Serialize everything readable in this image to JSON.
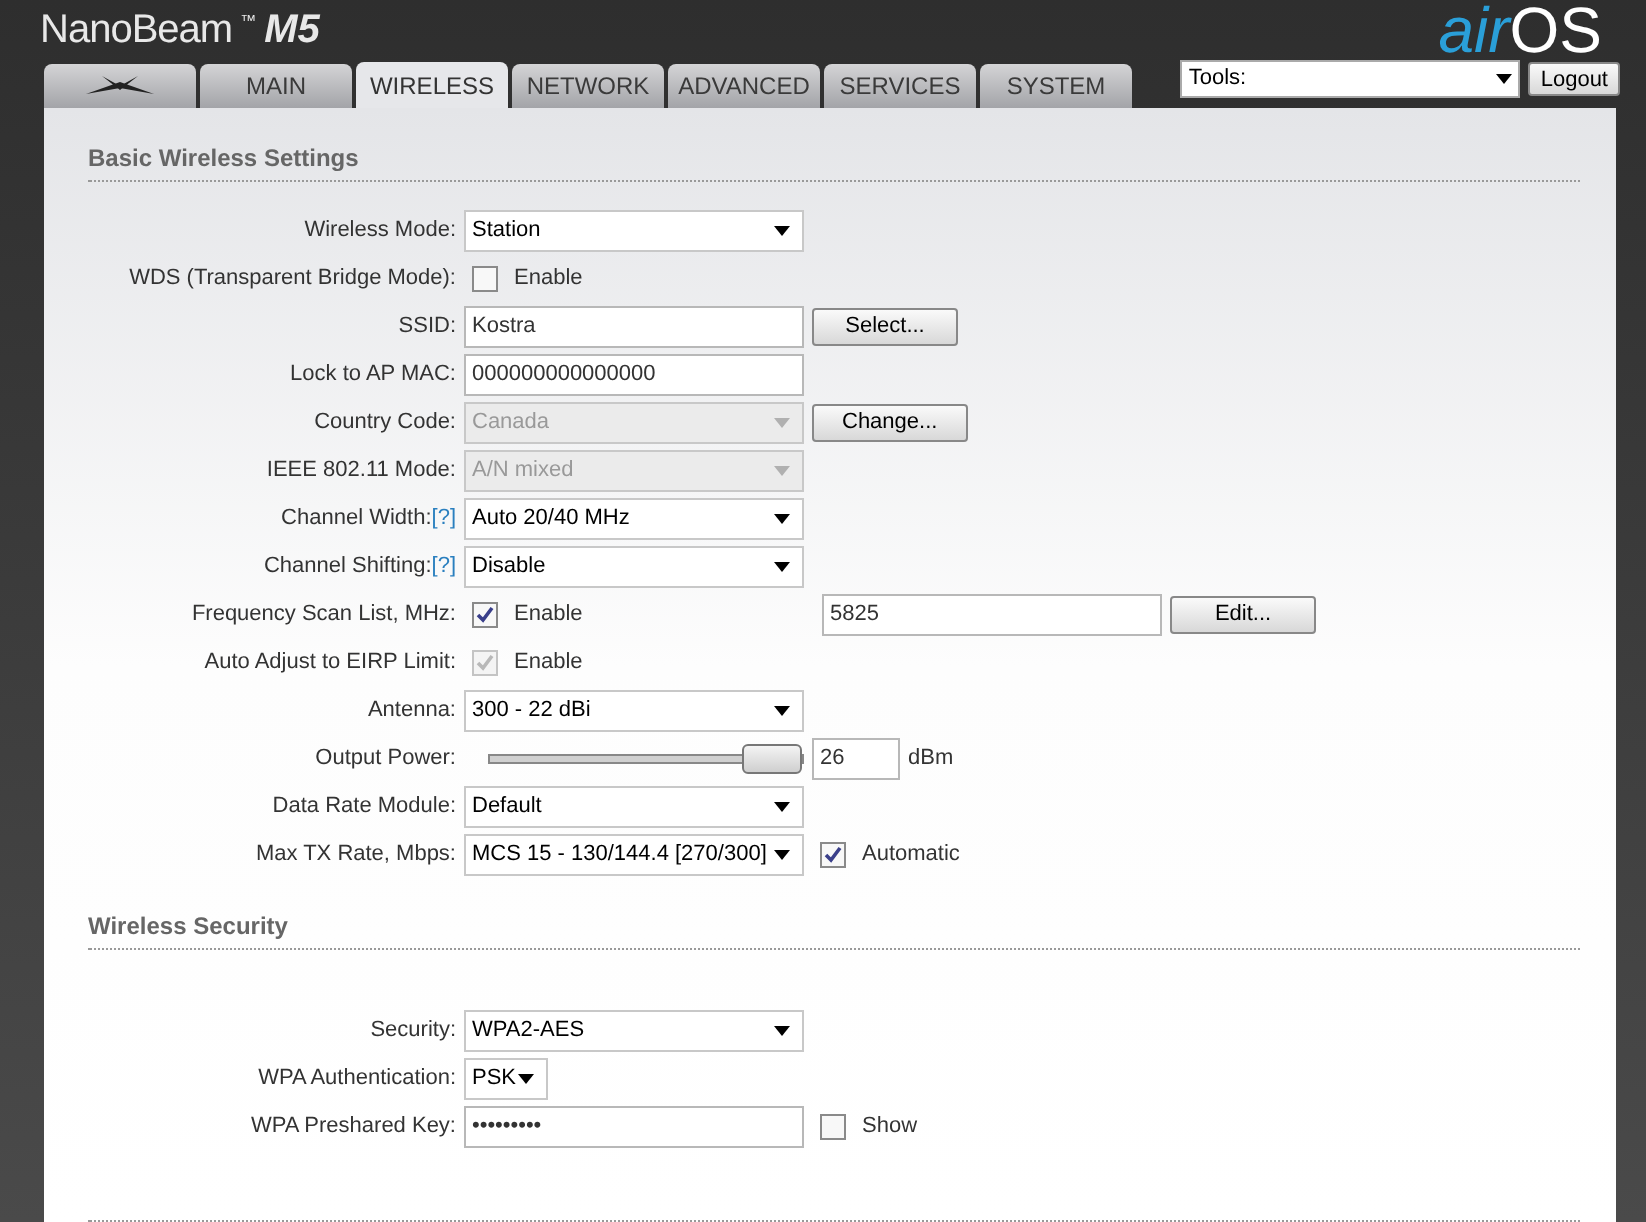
{
  "header": {
    "product": "NanoBeam",
    "product_tm": "™",
    "model": "M5",
    "logo_prefix": "air",
    "logo_suffix": "OS"
  },
  "tabs": [
    {
      "kind": "logo",
      "selected": false
    },
    {
      "kind": "text",
      "label": "MAIN",
      "selected": false
    },
    {
      "kind": "text",
      "label": "WIRELESS",
      "selected": true
    },
    {
      "kind": "text",
      "label": "NETWORK",
      "selected": false
    },
    {
      "kind": "text",
      "label": "ADVANCED",
      "selected": false
    },
    {
      "kind": "text",
      "label": "SERVICES",
      "selected": false
    },
    {
      "kind": "text",
      "label": "SYSTEM",
      "selected": false
    }
  ],
  "tools": {
    "value": "Tools:",
    "logout": "Logout"
  },
  "sections": [
    {
      "title": "Basic Wireless Settings",
      "rows": [
        {
          "label": "Wireless Mode:",
          "controls": [
            {
              "kind": "select",
              "value": "Station",
              "disabled": false
            }
          ]
        },
        {
          "label": "WDS (Transparent Bridge Mode):",
          "controls": [
            {
              "kind": "checkbox",
              "label": "Enable",
              "checked": false,
              "disabled": false
            }
          ]
        },
        {
          "label": "SSID:",
          "controls": [
            {
              "kind": "input",
              "value": "Kostra"
            },
            {
              "kind": "button",
              "label": "Select..."
            }
          ]
        },
        {
          "label": "Lock to AP MAC:",
          "controls": [
            {
              "kind": "input",
              "value": "000000000000000"
            }
          ]
        },
        {
          "label": "Country Code:",
          "controls": [
            {
              "kind": "select",
              "value": "Canada",
              "disabled": true
            },
            {
              "kind": "button",
              "label": "Change..."
            }
          ]
        },
        {
          "label": "IEEE 802.11 Mode:",
          "controls": [
            {
              "kind": "select",
              "value": "A/N mixed",
              "disabled": true
            }
          ]
        },
        {
          "label": "Channel Width:",
          "help": "[?]",
          "controls": [
            {
              "kind": "select",
              "value": "Auto 20/40 MHz",
              "disabled": false
            }
          ]
        },
        {
          "label": "Channel Shifting:",
          "help": "[?]",
          "controls": [
            {
              "kind": "select",
              "value": "Disable",
              "disabled": false
            }
          ]
        },
        {
          "label": "Frequency Scan List, MHz:",
          "controls": [
            {
              "kind": "checkbox",
              "label": "Enable",
              "checked": true,
              "disabled": false
            },
            {
              "kind": "wide_input",
              "value": "5825"
            },
            {
              "kind": "button",
              "label": "Edit..."
            }
          ]
        },
        {
          "label": "Auto Adjust to EIRP Limit:",
          "controls": [
            {
              "kind": "checkbox",
              "label": "Enable",
              "checked": true,
              "disabled": true
            }
          ]
        },
        {
          "label": "Antenna:",
          "controls": [
            {
              "kind": "select",
              "value": "300 - 22 dBi",
              "disabled": false
            }
          ]
        },
        {
          "label": "Output Power:",
          "controls": [
            {
              "kind": "slider",
              "level": 1
            },
            {
              "kind": "short_input",
              "value": "26"
            },
            {
              "kind": "unit",
              "text": "dBm"
            }
          ]
        },
        {
          "label": "Data Rate Module:",
          "controls": [
            {
              "kind": "select",
              "value": "Default",
              "disabled": false
            }
          ]
        },
        {
          "label": "Max TX Rate, Mbps:",
          "controls": [
            {
              "kind": "select",
              "value": "MCS 15 - 130/144.4 [270/300]",
              "disabled": false
            },
            {
              "kind": "small_checkbox",
              "label": "Automatic",
              "checked": true,
              "disabled": false
            }
          ]
        }
      ]
    },
    {
      "title": "Wireless Security",
      "rows": [
        {
          "label": "Security:",
          "controls": [
            {
              "kind": "select",
              "value": "WPA2-AES",
              "disabled": false
            }
          ]
        },
        {
          "label": "WPA Authentication:",
          "controls": [
            {
              "kind": "small_select",
              "value": "PSK",
              "disabled": false
            }
          ]
        },
        {
          "label": "WPA Preshared Key:",
          "controls": [
            {
              "kind": "input",
              "value": "•••••••••"
            },
            {
              "kind": "small_checkbox",
              "label": "Show",
              "checked": false,
              "disabled": false
            }
          ]
        }
      ]
    }
  ]
}
